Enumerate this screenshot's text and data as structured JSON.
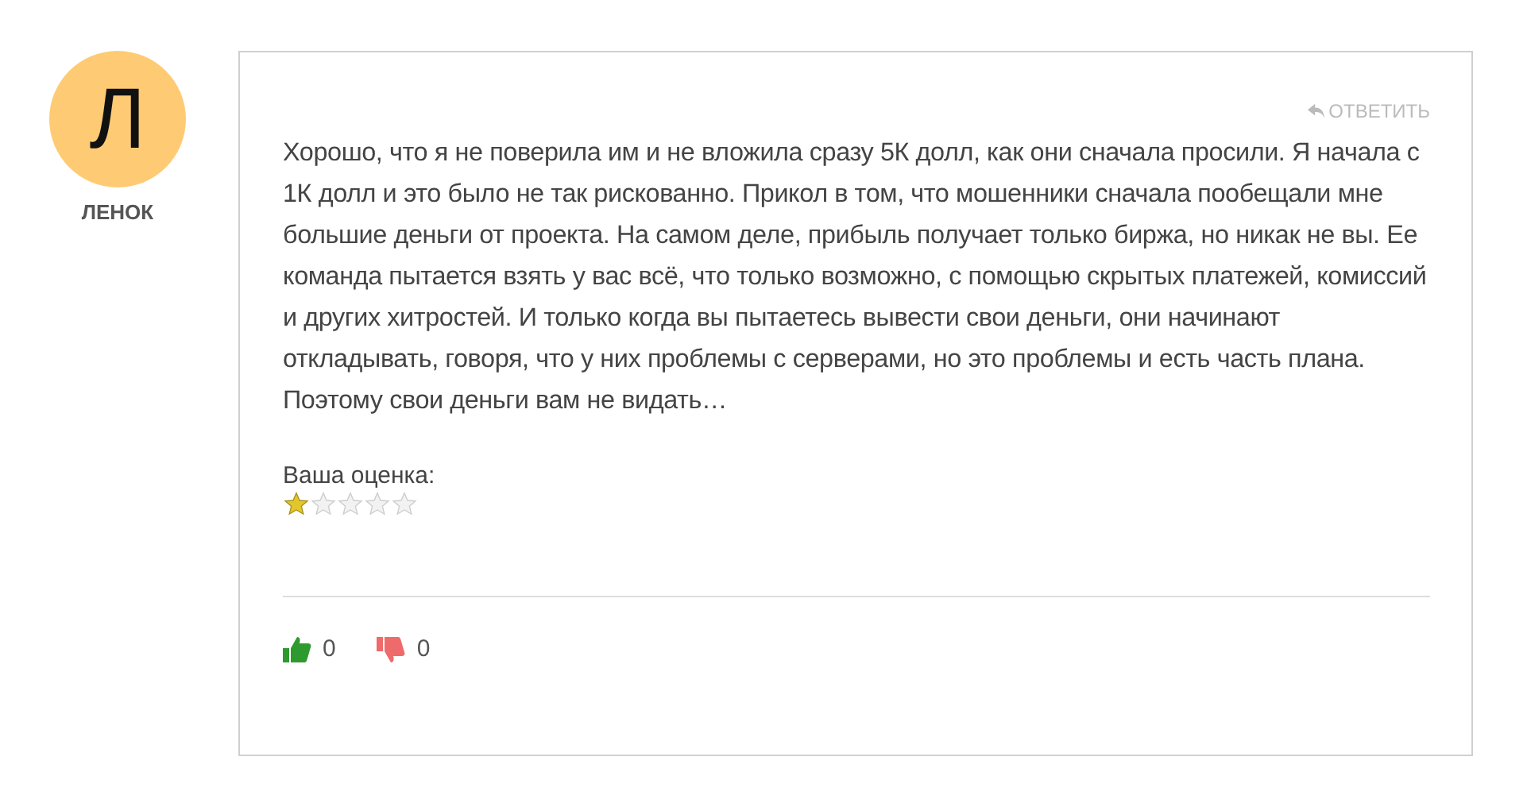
{
  "author": {
    "initial": "Л",
    "name": "ЛЕНОК"
  },
  "reply_button": "ОТВЕТИТЬ",
  "comment": "Хорошо, что я не поверила им и не вложила сразу 5К долл, как они сначала просили. Я начала с 1К долл и это было не так рискованно. Прикол в том, что мошенники сначала пообещали мне большие деньги от проекта. На самом деле, прибыль получает только биржа, но никак не вы. Ее команда пытается взять у вас всё, что только возможно, с помощью скрытых платежей, комиссий и других хитростей. И только когда вы пытаетесь вывести свои деньги, они начинают откладывать, говоря, что у них проблемы с серверами, но это проблемы и есть часть плана. Поэтому свои деньги вам не видать…",
  "rating": {
    "label": "Ваша оценка:",
    "stars": 1
  },
  "votes": {
    "likes": "0",
    "dislikes": "0"
  }
}
